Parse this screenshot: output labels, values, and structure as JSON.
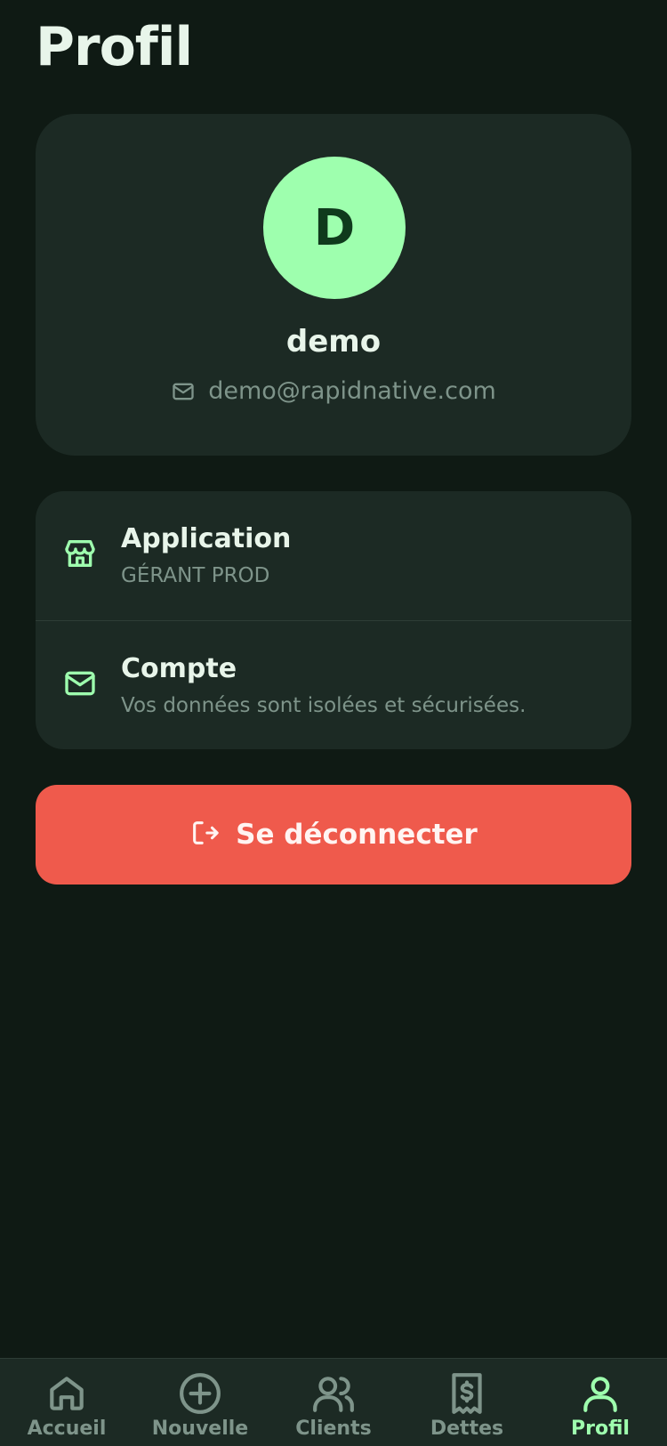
{
  "page": {
    "title": "Profil"
  },
  "profile": {
    "avatar_initial": "D",
    "name": "demo",
    "email": "demo@rapidnative.com"
  },
  "info": [
    {
      "title": "Application",
      "subtitle": "GÉRANT PROD",
      "icon": "store-icon"
    },
    {
      "title": "Compte",
      "subtitle": "Vos données sont isolées et sécurisées.",
      "icon": "mail-icon"
    }
  ],
  "logout": {
    "label": "Se déconnecter",
    "icon": "logout-icon"
  },
  "nav": {
    "items": [
      {
        "label": "Accueil",
        "icon": "home-icon",
        "active": false
      },
      {
        "label": "Nouvelle",
        "icon": "plus-circle-icon",
        "active": false
      },
      {
        "label": "Clients",
        "icon": "users-icon",
        "active": false
      },
      {
        "label": "Dettes",
        "icon": "receipt-icon",
        "active": false
      },
      {
        "label": "Profil",
        "icon": "user-icon",
        "active": true
      }
    ]
  },
  "colors": {
    "background": "#0f1a14",
    "card": "#1c2a24",
    "accent": "#9effae",
    "danger": "#ef5a4c",
    "muted": "#7e948a"
  }
}
